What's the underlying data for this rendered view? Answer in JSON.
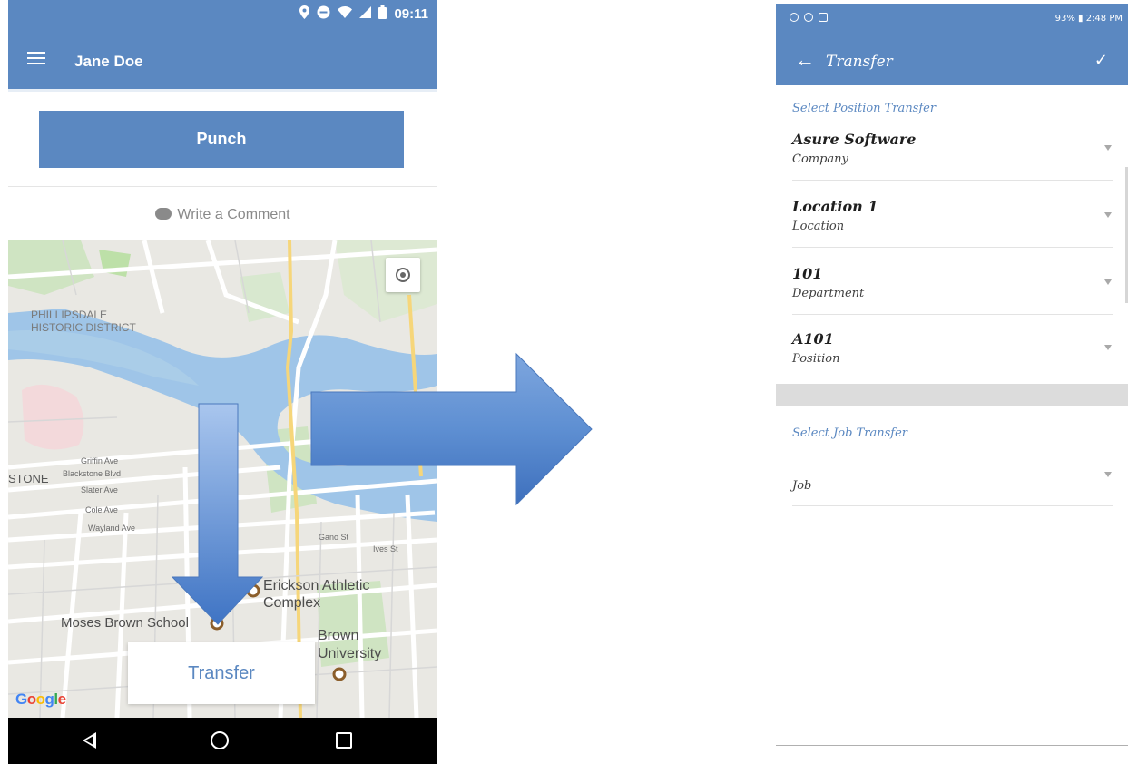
{
  "left_screen": {
    "status_bar": {
      "time": "09:11"
    },
    "app_bar": {
      "user_name": "Jane Doe"
    },
    "punch_label": "Punch",
    "comment_label": "Write a Comment",
    "map": {
      "labels": {
        "district": "PHILLIPSDALE\nHISTORIC DISTRICT",
        "stone": "STONE",
        "griffin": "Griffin Ave",
        "blackstone": "Blackstone Blvd",
        "slater": "Slater Ave",
        "cole": "Cole Ave",
        "wayland": "Wayland Ave",
        "gano": "Gano St",
        "ives": "Ives St"
      },
      "pois": {
        "erickson": "Erickson Athletic\nComplex",
        "moses": "Moses Brown School",
        "brown": "Brown\nUniversity"
      },
      "logo": "Google"
    },
    "transfer_label": "Transfer"
  },
  "right_screen": {
    "status_bar": {
      "right_text": "93% ▮ 2:48 PM"
    },
    "app_bar": {
      "back_glyph": "←",
      "title": "Transfer",
      "check_glyph": "✓"
    },
    "position_section_title": "Select Position Transfer",
    "fields": [
      {
        "value": "Asure Software",
        "label": "Company"
      },
      {
        "value": "Location 1",
        "label": "Location"
      },
      {
        "value": "101",
        "label": "Department"
      },
      {
        "value": "A101",
        "label": "Position"
      }
    ],
    "job_section_title": "Select Job Transfer",
    "job_field": {
      "label": "Job"
    }
  },
  "colors": {
    "primary": "#5b88c1",
    "arrow": "#5a8ed4"
  },
  "icons": [
    "menu-icon",
    "location-pin-icon",
    "dnd-icon",
    "wifi-icon",
    "signal-icon",
    "battery-icon",
    "chat-bubble-icon",
    "my-location-icon",
    "back-nav-icon",
    "home-nav-icon",
    "recents-nav-icon",
    "back-arrow-icon",
    "check-icon",
    "dropdown-caret-icon"
  ]
}
